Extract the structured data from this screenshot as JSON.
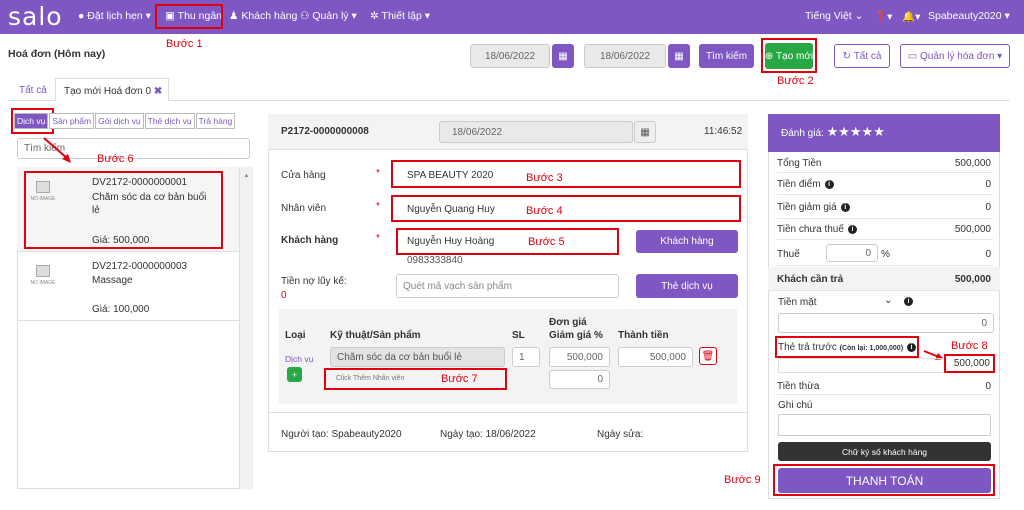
{
  "nav": {
    "logo": "salo",
    "items": [
      {
        "label": "Đặt lịch hẹn",
        "icon": "clock-icon"
      },
      {
        "label": "Thu ngân",
        "icon": "cashier-icon"
      },
      {
        "label": "Khách hàng",
        "icon": "user-icon"
      },
      {
        "label": "Quản lý",
        "icon": "users-icon"
      },
      {
        "label": "Thiết lập",
        "icon": "cogs-icon"
      }
    ],
    "language": "Tiếng Việt",
    "account": "Spabeauty2020"
  },
  "steps": {
    "s1": "Bước 1",
    "s2": "Bước 2",
    "s3": "Bước 3",
    "s4": "Bước 4",
    "s5": "Bước 5",
    "s6": "Bước 6",
    "s7": "Bước 7",
    "s8": "Bước 8",
    "s9": "Bước 9"
  },
  "header": {
    "title": "Hoá đơn (Hôm nay)",
    "date_from": "18/06/2022",
    "date_to": "18/06/2022",
    "search_label": "Tìm kiếm",
    "new_label": "Tạo mới",
    "all_label": "Tất cả",
    "manage_label": "Quản lý hóa đơn"
  },
  "tabs": {
    "all": "Tất cả",
    "new": "Tạo mới Hoá đơn 0"
  },
  "left": {
    "tabs": [
      "Dịch vụ",
      "Sản phẩm",
      "Gói dịch vụ",
      "Thẻ dịch vụ",
      "Trả hàng"
    ],
    "search_placeholder": "Tìm kiếm",
    "noimg": "NO IMAGE",
    "items": [
      {
        "code": "DV2172-0000000001",
        "name": "Chăm sóc da cơ bản buổi lẻ",
        "price": "Giá: 500,000"
      },
      {
        "code": "DV2172-0000000003",
        "name": "Massage",
        "price": "Giá: 100,000"
      }
    ]
  },
  "invoice": {
    "code": "P2172-0000000008",
    "date": "18/06/2022",
    "time": "11:46:52",
    "store_label": "Cửa hàng",
    "store_value": "SPA BEAUTY 2020",
    "staff_label": "Nhân viên",
    "staff_value": "Nguyễn Quang Huy",
    "customer_label": "Khách hàng",
    "customer_value": "Nguyễn Huy Hoàng",
    "customer_phone": "0983333840",
    "customer_btn": "Khách hàng",
    "debt_label": "Tiền nợ lũy kế:",
    "debt_value": "0",
    "barcode_placeholder": "Quét mã vạch sản phẩm",
    "service_card_btn": "Thẻ dịch vụ",
    "table": {
      "headers": {
        "type": "Loại",
        "tech": "Kỹ thuật/Sản phẩm",
        "qty": "SL",
        "unit_price": "Đơn giá",
        "discount": "Giảm giá %",
        "total": "Thành tiền"
      },
      "row": {
        "type": "Dịch vụ",
        "product": "Chăm sóc da cơ bản buổi lẻ",
        "qty": "1",
        "unit_price": "500,000",
        "total": "500,000",
        "discount": "0",
        "staff_placeholder": "Click Thêm Nhân viên"
      }
    },
    "creator": "Người tạo: Spabeauty2020",
    "created_date": "Ngày tạo: 18/06/2022",
    "modified": "Ngày sửa:"
  },
  "summary": {
    "rating_label": "Đánh giá:",
    "stars": "★★★★★",
    "total_label": "Tổng Tiền",
    "total": "500,000",
    "points_label": "Tiền điểm",
    "points": "0",
    "discount_label": "Tiền giảm giá",
    "discount": "0",
    "pretax_label": "Tiền chưa thuế",
    "pretax": "500,000",
    "tax_label": "Thuế",
    "tax_value": "0",
    "tax_unit": "%",
    "tax": "0",
    "payable_label": "Khách cần trả",
    "payable": "500,000",
    "cash_label": "Tiền mặt",
    "cash": "0",
    "prepaid_label": "Thẻ trả trước",
    "prepaid_remaining": "(Còn lại: 1,000,000)",
    "prepaid": "500,000",
    "change_label": "Tiền thừa",
    "change": "0",
    "note_label": "Ghi chú",
    "signature_btn": "Chữ ký số khách hàng",
    "pay_btn": "THANH TOÁN"
  }
}
